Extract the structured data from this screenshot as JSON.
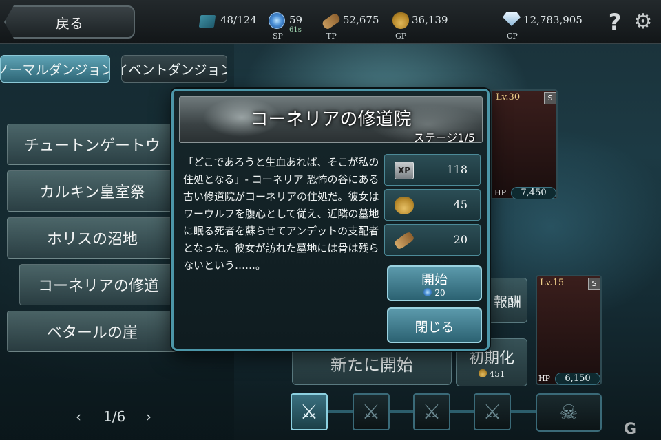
{
  "topbar": {
    "back_label": "戻る",
    "cards": {
      "value": "48/124",
      "icon": "card-icon"
    },
    "sp": {
      "value": "59",
      "timer": "61s",
      "label": "SP",
      "icon": "sp-orb-icon"
    },
    "tp": {
      "value": "52,675",
      "label": "TP",
      "icon": "scroll-icon"
    },
    "gp": {
      "value": "36,139",
      "label": "GP",
      "icon": "gold-bag-icon"
    },
    "cp": {
      "value": "12,783,905",
      "label": "CP",
      "icon": "diamond-icon"
    },
    "help_icon": "?",
    "settings_icon": "⚙"
  },
  "tabs": {
    "normal": "ノーマルダンジョン",
    "event": "イベントダンジョン"
  },
  "dungeons": [
    "チュートンゲートウ",
    "カルキン皇室祭",
    "ホリスの沼地",
    "コーネリアの修道",
    "ベタールの崖"
  ],
  "pager": {
    "prev": "‹",
    "page": "1/6",
    "next": "›"
  },
  "party": {
    "card1": {
      "level": "Lv.30",
      "rank": "S",
      "hp_label": "HP",
      "hp": "7,450"
    },
    "card2": {
      "level": "Lv.15",
      "rank": "S",
      "hp_label": "HP",
      "hp": "6,150"
    }
  },
  "background_buttons": {
    "reward": "報酬",
    "new_start": "新たに開始",
    "reset": "初期化",
    "reset_cost": "451"
  },
  "modal": {
    "title": "コーネリアの修道院",
    "stage": "ステージ1/5",
    "description": "「どこであろうと生血あれば、そこが私の住処となる」- コーネリア 恐怖の谷にある古い修道院がコーネリアの住処だ。彼女はワーウルフを腹心として従え、近隣の墓地に眠る死者を蘇らせてアンデットの支配者となった。彼女が訪れた墓地には骨は残らないという……。",
    "rewards": [
      {
        "icon": "xp-icon",
        "icon_text": "XP",
        "value": "118"
      },
      {
        "icon": "gold-bag-icon",
        "value": "45"
      },
      {
        "icon": "scroll-icon",
        "value": "20"
      }
    ],
    "start_label": "開始",
    "start_cost": "20",
    "close_label": "閉じる"
  },
  "stage_progress": {
    "current": 1,
    "total": 5,
    "boss_icon": "skull-icon"
  },
  "watermark": "G"
}
